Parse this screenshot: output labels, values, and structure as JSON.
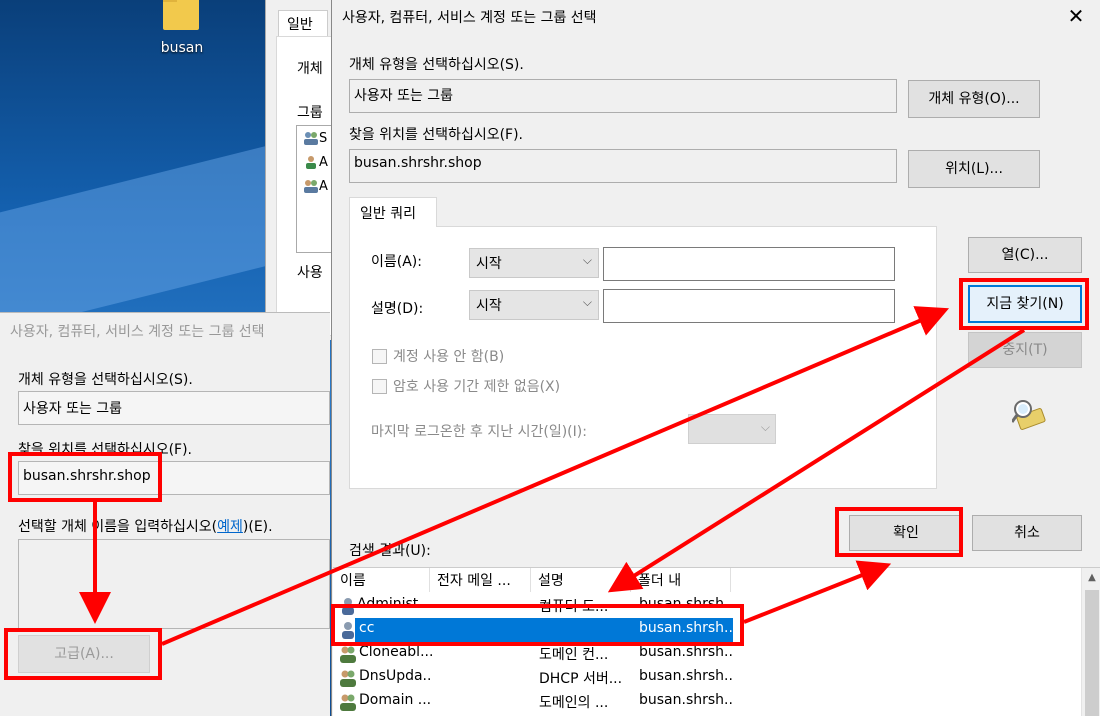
{
  "desktop": {
    "icon_label": "busan",
    "icon_name": "folder-icon"
  },
  "bg_window": {
    "tab_label": "일반",
    "object_label": "개체",
    "group_label": "그룹",
    "usage_label": "사용",
    "list_items": [
      "S",
      "A",
      "A"
    ]
  },
  "small_dialog": {
    "title": "사용자, 컴퓨터, 서비스 계정 또는 그룹 선택",
    "object_type_label": "개체 유형을 선택하십시오(S).",
    "object_type_value": "사용자 또는 그룹",
    "location_label": "찾을 위치를 선택하십시오(F).",
    "location_value": "busan.shrshr.shop",
    "enter_names_label_prefix": "선택할 개체 이름을 입력하십시오(",
    "enter_names_link": "예제",
    "enter_names_label_suffix": ")(E).",
    "advanced_button": "고급(A)..."
  },
  "main_dialog": {
    "title": "사용자, 컴퓨터, 서비스 계정 또는 그룹 선택",
    "close_icon": "close-icon",
    "object_type_label": "개체 유형을 선택하십시오(S).",
    "object_type_value": "사용자 또는 그룹",
    "object_type_button": "개체 유형(O)...",
    "location_label": "찾을 위치를 선택하십시오(F).",
    "location_value": "busan.shrshr.shop",
    "location_button": "위치(L)...",
    "query_tab": "일반 쿼리",
    "name_label": "이름(A):",
    "name_combo": "시작",
    "description_label": "설명(D):",
    "description_combo": "시작",
    "disabled_accounts": "계정 사용 안 함(B)",
    "non_expiring_passwords": "암호 사용 기간 제한 없음(X)",
    "days_since_logon": "마지막 로그온한 후 지난 시간(일)(I):",
    "columns_button": "열(C)...",
    "find_now_button": "지금 찾기(N)",
    "stop_button": "중지(T)",
    "ok_button": "확인",
    "cancel_button": "취소",
    "results_label": "검색 결과(U):",
    "results_columns": [
      "이름",
      "전자 메일 ...",
      "설명",
      "폴더 내"
    ],
    "results_rows": [
      {
        "name": "Administ...",
        "email": "",
        "description": "컴퓨터 도...",
        "folder": "busan.shrsh...",
        "icon": "user-icon"
      },
      {
        "name": "cc",
        "email": "",
        "description": "",
        "folder": "busan.shrsh...",
        "icon": "user-icon"
      },
      {
        "name": "Cloneabl...",
        "email": "",
        "description": "도메인 컨...",
        "folder": "busan.shrsh...",
        "icon": "group-icon"
      },
      {
        "name": "DnsUpda...",
        "email": "",
        "description": "DHCP 서버...",
        "folder": "busan.shrsh...",
        "icon": "group-icon"
      },
      {
        "name": "Domain ...",
        "email": "",
        "description": "도메인의 ...",
        "folder": "busan.shrsh...",
        "icon": "group-icon"
      }
    ],
    "selected_row_index": 1
  },
  "annotations": {
    "color": "#ff0000"
  },
  "colors": {
    "selection": "#0078d7",
    "focus_border": "#0078d7",
    "dialog_bg": "#f0f0f0"
  }
}
